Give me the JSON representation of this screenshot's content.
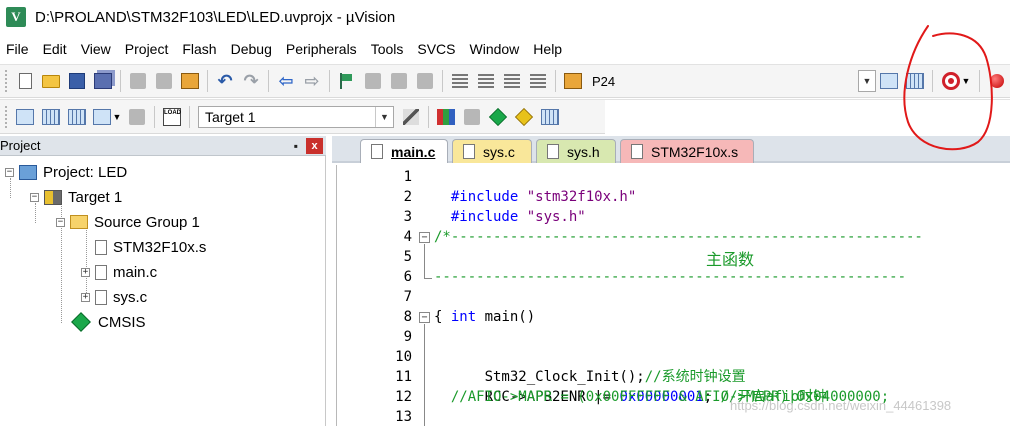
{
  "window": {
    "title": "D:\\PROLAND\\STM32F103\\LED\\LED.uvprojx - µVision",
    "app_icon_letter": "V"
  },
  "menu": [
    "File",
    "Edit",
    "View",
    "Project",
    "Flash",
    "Debug",
    "Peripherals",
    "Tools",
    "SVCS",
    "Window",
    "Help"
  ],
  "toolbar1": {
    "find_text": "P24"
  },
  "toolbar2": {
    "load_label": "LOAD",
    "target_value": "Target 1"
  },
  "project_panel": {
    "title": "Project",
    "pin": "ᵒ",
    "close": "x",
    "tree": [
      {
        "label": "Project: LED",
        "icon": "project-icon"
      },
      {
        "label": "Target 1",
        "icon": "target-icon"
      },
      {
        "label": "Source Group 1",
        "icon": "folder-icon"
      },
      {
        "label": "STM32F10x.s",
        "icon": "file-icon"
      },
      {
        "label": "main.c",
        "icon": "file-icon"
      },
      {
        "label": "sys.c",
        "icon": "file-icon"
      },
      {
        "label": "CMSIS",
        "icon": "cmsis-gem-icon"
      }
    ]
  },
  "tabs": [
    {
      "label": "main.c",
      "active": true,
      "color": "#ffffff"
    },
    {
      "label": "sys.c",
      "active": false,
      "color": "#f9e79a"
    },
    {
      "label": "sys.h",
      "active": false,
      "color": "#d8e8b0"
    },
    {
      "label": "STM32F10x.s",
      "active": false,
      "color": "#f6b8b8"
    }
  ],
  "editor": {
    "line_numbers": [
      "1",
      "2",
      "3",
      "4",
      "5",
      "6",
      "7",
      "8",
      "9",
      "10",
      "11",
      "12",
      "13"
    ],
    "line1_pp": "#include ",
    "line1_str": "\"stm32f10x.h\"",
    "line2_pp": "#include ",
    "line2_str": "\"sys.h\"",
    "line4": "/*--------------------------------------------------------",
    "line5_center": "主函数",
    "line6": "--------------------------------------------------------",
    "line7_kw": "int",
    "line7_rest": " main()",
    "line8": "{",
    "line10_code": "    Stm32_Clock_Init();",
    "line10_cm": "//系统时钟设置",
    "line11_code": "    RCC->APB2ENR |= ",
    "line11_num": "0x00000001",
    "line11_semi": "; ",
    "line11_cm": "//开启afio时钟",
    "line12_cm": "  //AFIO->MAPR = (0x00FFFFFF & AFIO->MAPR)|0x04000000;"
  },
  "colors": {
    "annotation": "#e11919",
    "keyword": "#0000ff",
    "comment": "#1a9a2a"
  },
  "watermark": "https://blog.csdn.net/weixin_44461398"
}
